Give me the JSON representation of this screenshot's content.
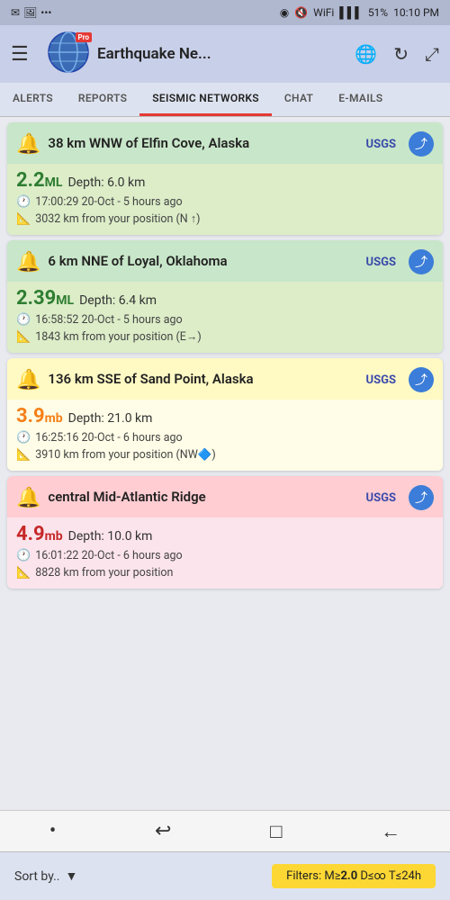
{
  "statusBar": {
    "leftIcons": [
      "✉",
      "📷",
      "📶"
    ],
    "battery": "51%",
    "time": "10:10 PM",
    "locationIcon": "📍",
    "muteIcon": "🔇",
    "wifiIcon": "📶",
    "signalIcon": "📶"
  },
  "header": {
    "menuIcon": "☰",
    "appName": "Earthquake Ne...",
    "proBadge": "Pro",
    "globeIcon": "🌐",
    "refreshIcon": "↻",
    "expandIcon": "⤢"
  },
  "tabs": [
    {
      "id": "alerts",
      "label": "ALERTS",
      "active": false
    },
    {
      "id": "reports",
      "label": "REPORTS",
      "active": false
    },
    {
      "id": "seismic",
      "label": "SEISMIC NETWORKS",
      "active": true
    },
    {
      "id": "chat",
      "label": "CHAT",
      "active": false
    },
    {
      "id": "emails",
      "label": "E-MAILS",
      "active": false
    }
  ],
  "earthquakes": [
    {
      "id": "eq1",
      "location": "38 km WNW of Elfin Cove, Alaska",
      "magnitude": "2.2",
      "magType": "ML",
      "depth": "Depth: 6.0 km",
      "time": "17:00:29 20-Oct - 5 hours ago",
      "distance": "3032 km from your position (N ↑)",
      "source": "USGS",
      "color": "green",
      "magColor": "green"
    },
    {
      "id": "eq2",
      "location": "6 km NNE of Loyal, Oklahoma",
      "magnitude": "2.39",
      "magType": "ML",
      "depth": "Depth: 6.4 km",
      "time": "16:58:52 20-Oct - 5 hours ago",
      "distance": "1843 km from your position (E→)",
      "source": "USGS",
      "color": "green",
      "magColor": "green"
    },
    {
      "id": "eq3",
      "location": "136 km SSE of Sand Point, Alaska",
      "magnitude": "3.9",
      "magType": "mb",
      "depth": "Depth: 21.0 km",
      "time": "16:25:16 20-Oct - 6 hours ago",
      "distance": "3910 km from your position (NW🔷)",
      "source": "USGS",
      "color": "yellow",
      "magColor": "yellow"
    },
    {
      "id": "eq4",
      "location": "central Mid-Atlantic Ridge",
      "magnitude": "4.9",
      "magType": "mb",
      "depth": "Depth: 10.0 km",
      "time": "16:01:22 20-Oct - 6 hours ago",
      "distance": "8828 km from your position",
      "source": "USGS",
      "color": "red",
      "magColor": "red"
    }
  ],
  "bottomBar": {
    "sortLabel": "Sort by..",
    "dropdownIcon": "▼",
    "filterLabel": "Filters: M≥",
    "filterMag": "2.0",
    "filterDepth": " D≤∞ T≤24h"
  },
  "navBar": {
    "icons": [
      "•",
      "↩",
      "□",
      "←"
    ]
  }
}
